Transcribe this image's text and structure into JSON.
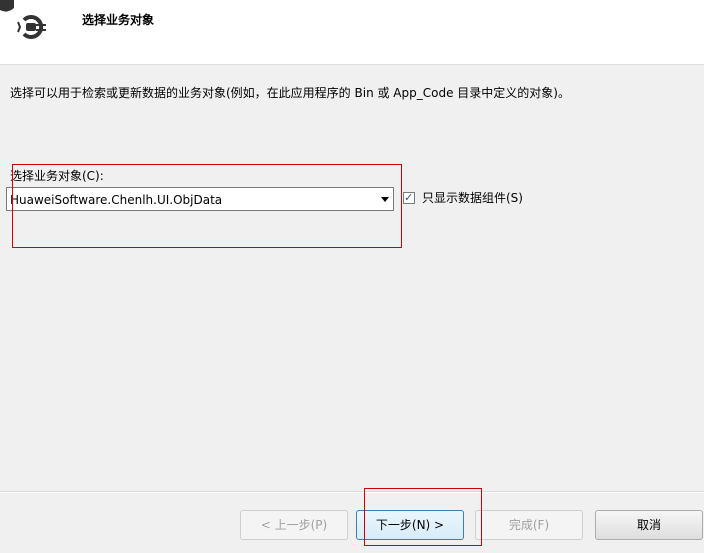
{
  "header": {
    "title": "选择业务对象",
    "icon": "plug-icon"
  },
  "description": "选择可以用于检索或更新数据的业务对象(例如，在此应用程序的 Bin 或 App_Code 目录中定义的对象)。",
  "business_object": {
    "label": "选择业务对象(C):",
    "selected_value": "HuaweiSoftware.Chenlh.UI.ObjData"
  },
  "data_components_only": {
    "label": "只显示数据组件(S)",
    "checked": true
  },
  "buttons": {
    "previous": "< 上一步(P)",
    "next": "下一步(N) >",
    "finish": "完成(F)",
    "cancel": "取消"
  },
  "colors": {
    "highlight": "#cc0000",
    "background": "#f0f0f0"
  }
}
